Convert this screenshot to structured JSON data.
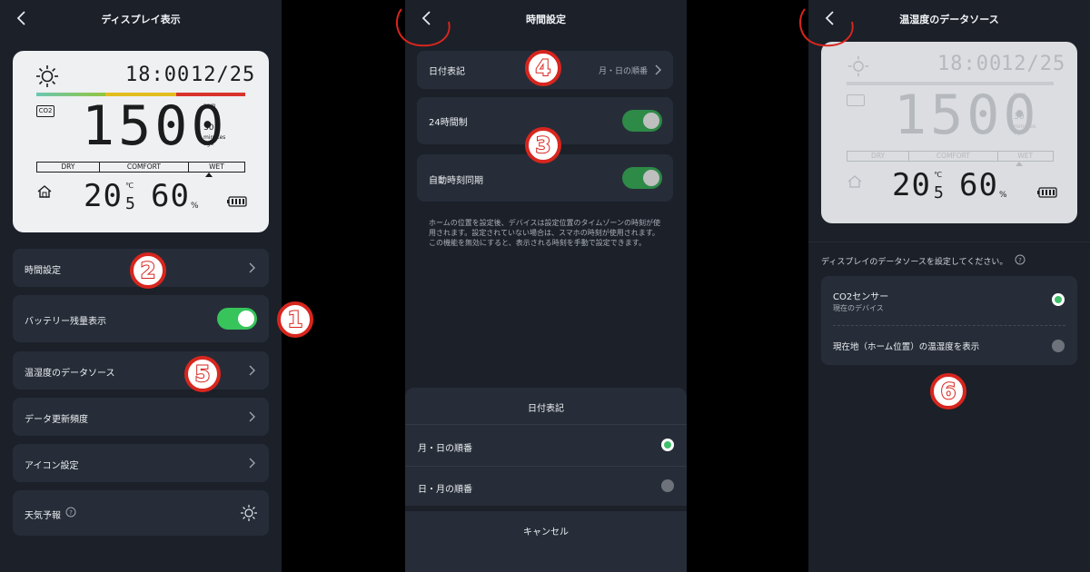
{
  "screen1": {
    "title": "ディスプレイ表示",
    "lcd": {
      "time": "18:00",
      "date": "12/25",
      "co2_label": "CO2",
      "co2_value": "1500",
      "ppm": "ppm",
      "ago_num": "30",
      "ago_l1": "minutes",
      "ago_l2": "ago",
      "dry": "DRY",
      "comfort": "COMFORT",
      "wet": "WET",
      "temp_main": "20",
      "temp_dec": "5",
      "temp_unit": "℃",
      "hum_value": "60",
      "hum_unit": "%"
    },
    "rows": [
      {
        "label": "時間設定"
      },
      {
        "label": "バッテリー残量表示"
      },
      {
        "label": "温湿度のデータソース"
      },
      {
        "label": "データ更新頻度"
      },
      {
        "label": "アイコン設定"
      },
      {
        "label": "天気予報"
      }
    ]
  },
  "screen2": {
    "title": "時間設定",
    "date_format_label": "日付表記",
    "date_format_value": "月・日の順番",
    "hour24_label": "24時間制",
    "auto_sync_label": "自動時刻同期",
    "note": "ホームの位置を設定後、デバイスは設定位置のタイムゾーンの時刻が使用されます。設定されていない場合は、スマホの時刻が使用されます。\nこの機能を無効にすると、表示される時刻を手動で設定できます。",
    "sheet_title": "日付表記",
    "options": [
      "月・日の順番",
      "日・月の順番"
    ],
    "cancel": "キャンセル"
  },
  "screen3": {
    "title": "温湿度のデータソース",
    "lcd": {
      "time": "18:00",
      "date": "12/25",
      "co2_value": "1500",
      "ppm": "ppm",
      "ago_num": "30",
      "ago_l1": "minutes",
      "ago_l2": "ago",
      "dry": "DRY",
      "comfort": "COMFORT",
      "wet": "WET",
      "temp_main": "20",
      "temp_dec": "5",
      "temp_unit": "℃",
      "hum_value": "60",
      "hum_unit": "%"
    },
    "prompt": "ディスプレイのデータソースを設定してください。",
    "option1_title": "CO2センサー",
    "option1_sub": "現在のデバイス",
    "option2_title": "現在地（ホーム位置）の温湿度を表示"
  },
  "badges": [
    "1",
    "2",
    "3",
    "4",
    "5",
    "6"
  ],
  "colors": {
    "bg": "#1b2029",
    "card": "#262d38",
    "toggle_on": "#36c45b",
    "accent_red": "#d7261e"
  }
}
